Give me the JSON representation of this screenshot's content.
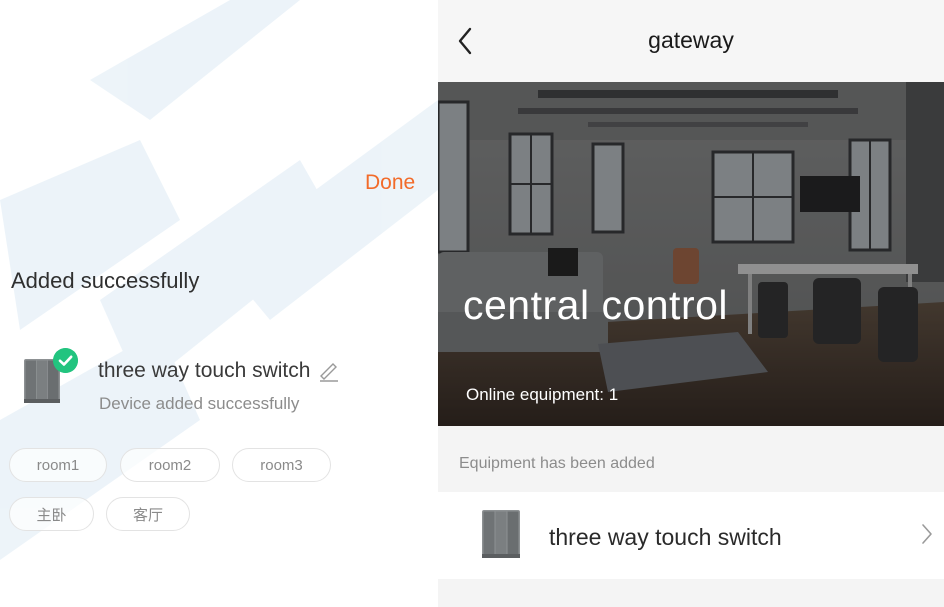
{
  "left": {
    "done_label": "Done",
    "heading": "Added successfully",
    "device": {
      "name": "three way touch switch",
      "status": "Device added successfully",
      "thumbnail_icon": "three-gang-switch-icon",
      "badge_icon": "check-circle-icon",
      "edit_icon": "pencil-icon"
    },
    "rooms": [
      "room1",
      "room2",
      "room3",
      "主卧",
      "客厅"
    ]
  },
  "right": {
    "back_icon": "chevron-left-icon",
    "title": "gateway",
    "hero": {
      "title": "central control",
      "subtitle": "Online equipment: 1"
    },
    "section_label": "Equipment has been added",
    "devices": [
      {
        "name": "three way touch switch",
        "icon": "three-gang-switch-icon",
        "trailing_icon": "chevron-right-icon"
      }
    ]
  },
  "colors": {
    "accent": "#f26b2a",
    "success": "#22c47f",
    "muted_text": "#8c8c8c",
    "panel_bg": "#f4f4f4"
  }
}
